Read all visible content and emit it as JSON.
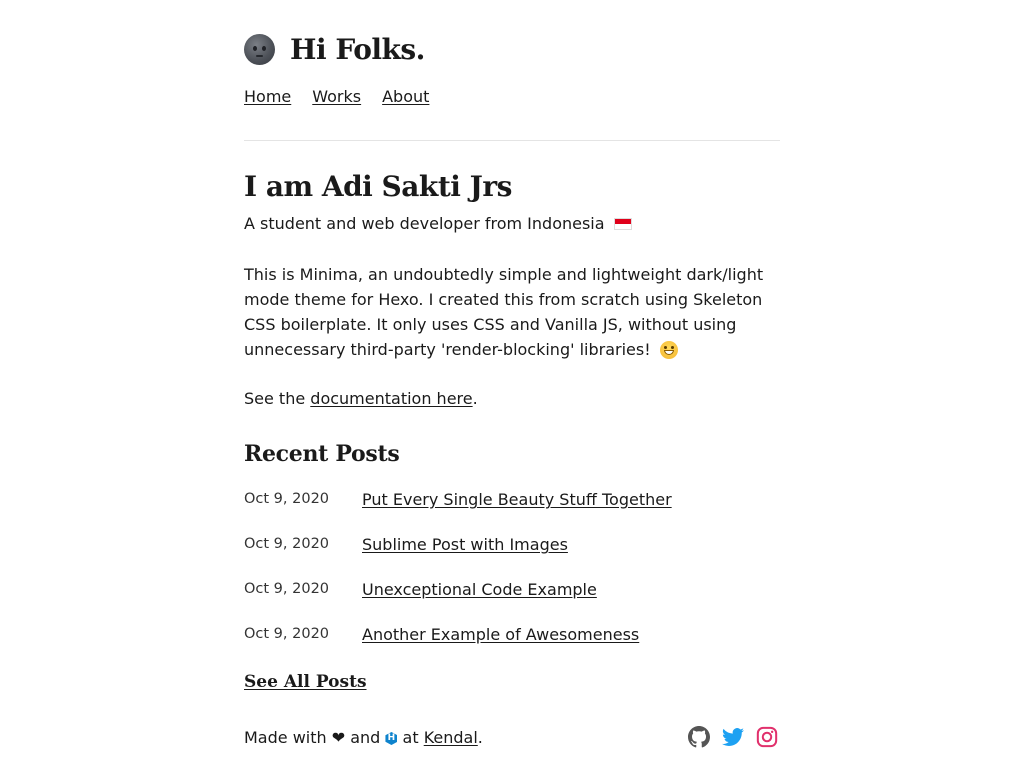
{
  "site": {
    "title": "Hi Folks.",
    "icon": "moon-face-icon"
  },
  "nav": {
    "items": [
      "Home",
      "Works",
      "About"
    ]
  },
  "hero": {
    "title": "I am Adi Sakti Jrs",
    "tagline": "A student and web developer from Indonesia",
    "flag_icon": "indonesia-flag-icon"
  },
  "intro": {
    "text": "This is Minima, an undoubtedly simple and lightweight dark/light mode theme for Hexo. I created this from scratch using Skeleton CSS boilerplate. It only uses CSS and Vanilla JS, without using unnecessary third-party 'render-blocking' libraries!",
    "emoji_icon": "grinning-face-icon"
  },
  "docs": {
    "prefix": "See the",
    "link_text": "documentation here",
    "suffix": "."
  },
  "recent_posts": {
    "title": "Recent Posts",
    "posts": [
      {
        "date": "Oct 9, 2020",
        "title": "Put Every Single Beauty Stuff Together"
      },
      {
        "date": "Oct 9, 2020",
        "title": "Sublime Post with Images"
      },
      {
        "date": "Oct 9, 2020",
        "title": "Unexceptional Code Example"
      },
      {
        "date": "Oct 9, 2020",
        "title": "Another Example of Awesomeness"
      }
    ],
    "see_all_label": "See All Posts"
  },
  "footer": {
    "made_with": "Made with",
    "heart": "❤",
    "and": "and",
    "hexo_glyph": "H",
    "at": "at",
    "author_link": "Kendal",
    "period": ".",
    "social_icons": [
      "github-icon",
      "twitter-icon",
      "instagram-icon"
    ],
    "colors": {
      "github": "#555555",
      "twitter": "#1da1f2",
      "instagram": "#e1306c"
    }
  }
}
